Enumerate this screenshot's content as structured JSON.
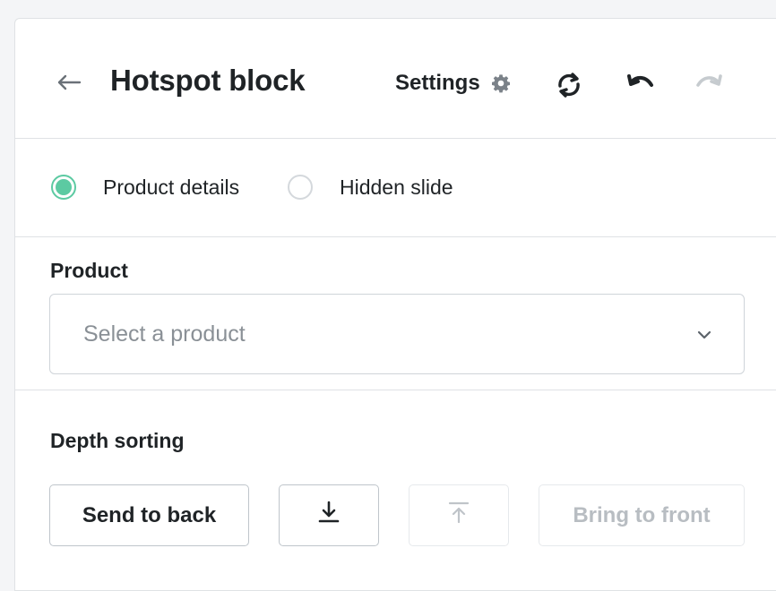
{
  "header": {
    "title": "Hotspot block",
    "settings_label": "Settings",
    "icons": {
      "back": "arrow-left-icon",
      "settings": "gear-icon",
      "refresh": "refresh-icon",
      "undo": "undo-icon",
      "redo": "redo-icon"
    }
  },
  "slide_type": {
    "options": [
      {
        "label": "Product details",
        "checked": true
      },
      {
        "label": "Hidden slide",
        "checked": false
      }
    ],
    "accent_color": "#5ccaa2"
  },
  "product": {
    "label": "Product",
    "select_placeholder": "Select a product"
  },
  "depth_sorting": {
    "label": "Depth sorting",
    "buttons": {
      "send_to_back": {
        "label": "Send to back",
        "enabled": true
      },
      "send_backward": {
        "icon": "send-backward-icon",
        "enabled": true
      },
      "bring_forward": {
        "icon": "bring-forward-icon",
        "enabled": false
      },
      "bring_to_front": {
        "label": "Bring to front",
        "enabled": false
      }
    }
  }
}
